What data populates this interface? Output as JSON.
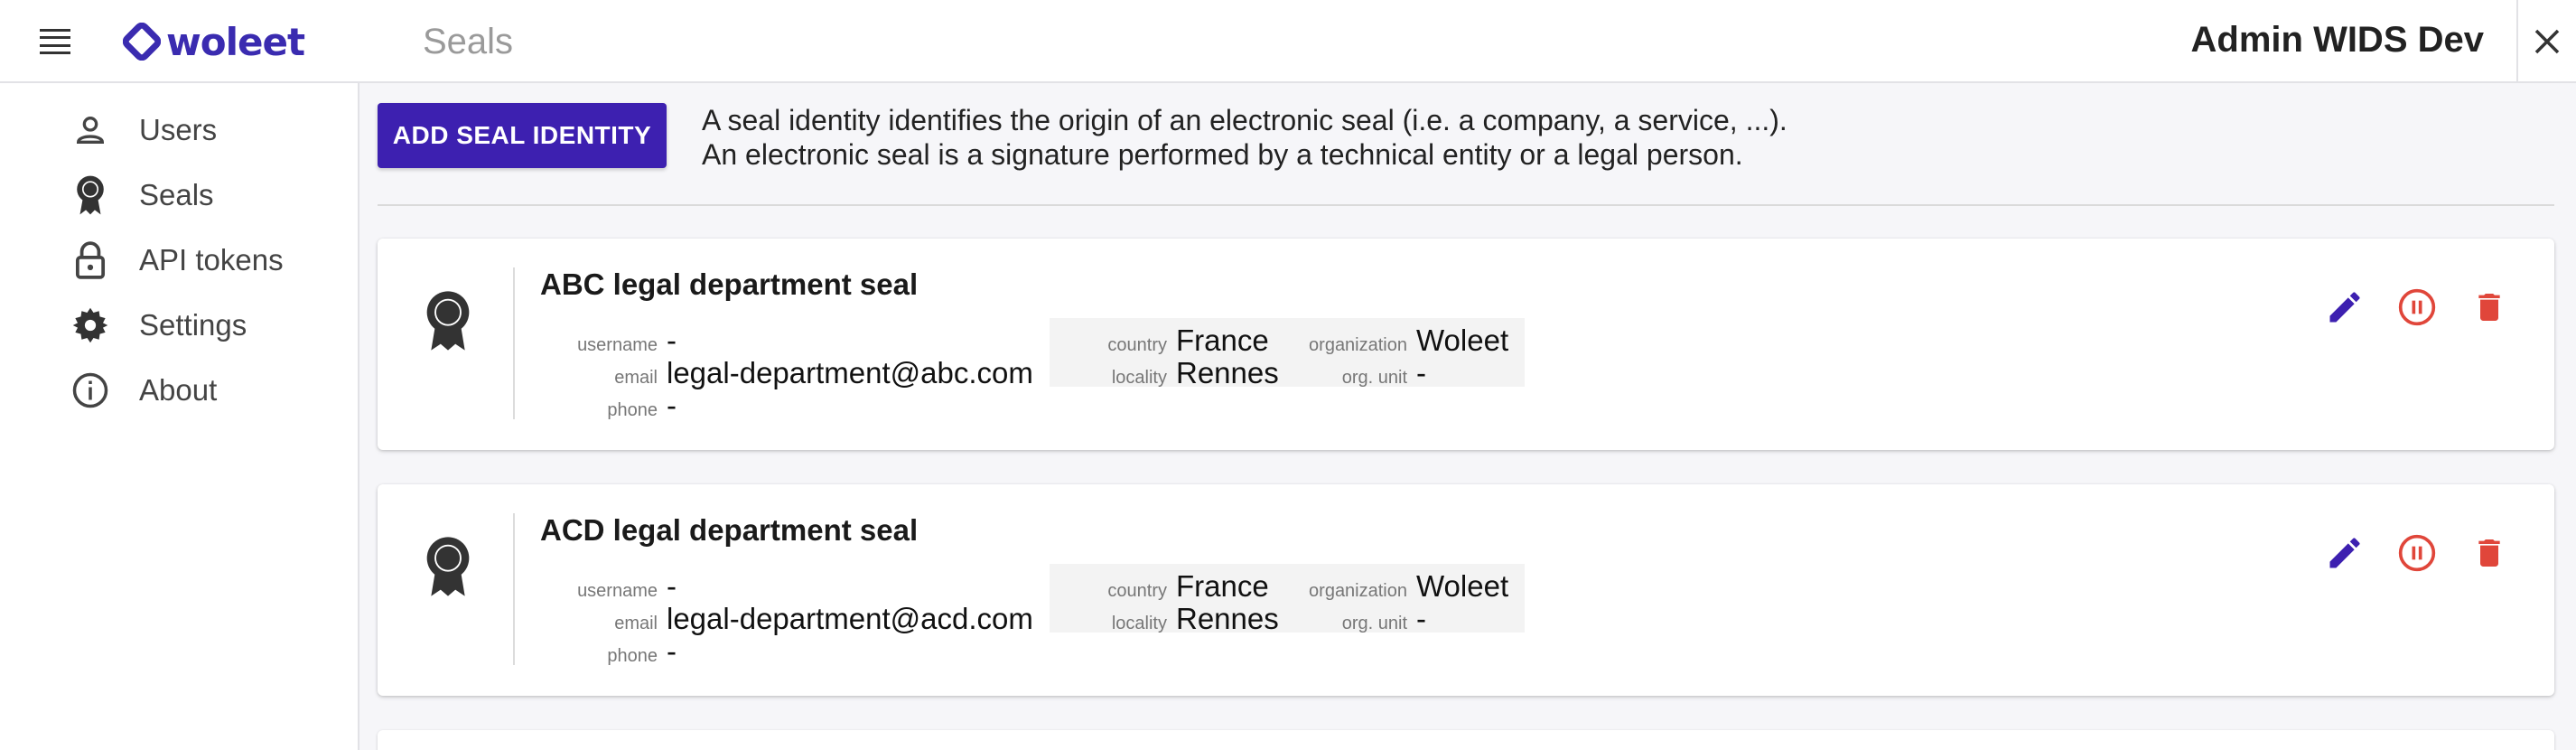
{
  "header": {
    "logo_text": "woleet",
    "section_title": "Seals",
    "user_name": "Admin WIDS Dev"
  },
  "sidebar": {
    "items": [
      {
        "label": "Users",
        "icon": "person-icon"
      },
      {
        "label": "Seals",
        "icon": "seal-icon"
      },
      {
        "label": "API tokens",
        "icon": "lock-icon"
      },
      {
        "label": "Settings",
        "icon": "gear-icon"
      },
      {
        "label": "About",
        "icon": "info-icon"
      }
    ]
  },
  "main": {
    "add_button_label": "ADD SEAL IDENTITY",
    "intro_line1": "A seal identity identifies the origin of an electronic seal (i.e. a company, a service, ...).",
    "intro_line2": "An electronic seal is a signature performed by a technical entity or a legal person.",
    "field_labels": {
      "username": "username",
      "email": "email",
      "phone": "phone",
      "country": "country",
      "locality": "locality",
      "organization": "organization",
      "org_unit": "org. unit"
    },
    "seals": [
      {
        "title": "ABC legal department seal",
        "username": "-",
        "email": "legal-department@abc.com",
        "phone": "-",
        "country": "France",
        "locality": "Rennes",
        "organization": "Woleet",
        "org_unit": "-"
      },
      {
        "title": "ACD legal department seal",
        "username": "-",
        "email": "legal-department@acd.com",
        "phone": "-",
        "country": "France",
        "locality": "Rennes",
        "organization": "Woleet",
        "org_unit": "-"
      }
    ]
  },
  "colors": {
    "brand": "#3d20b0",
    "edit_icon": "#3d20b0",
    "pause_icon": "#e0463a",
    "delete_icon": "#e0463a"
  }
}
